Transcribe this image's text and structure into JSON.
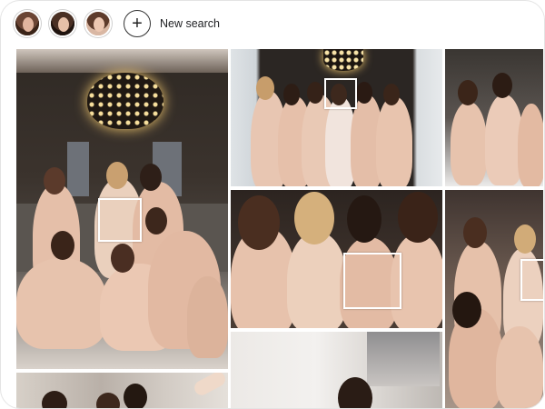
{
  "toolbar": {
    "new_search_label": "New search",
    "add_icon": "plus-circle-icon",
    "faces": [
      {
        "label": "face-1"
      },
      {
        "label": "face-2"
      },
      {
        "label": "face-3"
      }
    ]
  },
  "colors": {
    "robe": "#e8c1ac",
    "robe_shadow": "#c99b83",
    "dark_room": "#2a2522",
    "chandelier": "#f5d58a",
    "face_box": "#ffffff"
  }
}
